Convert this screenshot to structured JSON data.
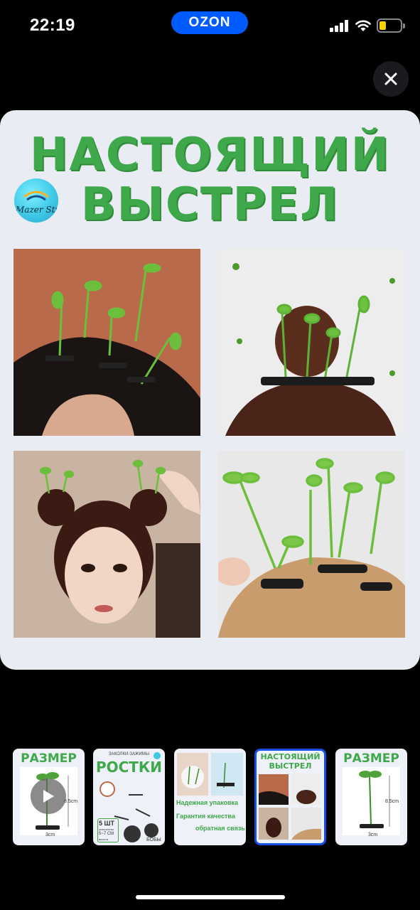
{
  "status_bar": {
    "time": "22:19",
    "brand": "OZON"
  },
  "product_image": {
    "headline_line1": "НАСТОЯЩИЙ",
    "headline_line2": "ВЫСТРЕЛ",
    "logo_text": "Mazer Studi"
  },
  "thumbnails": [
    {
      "title": "РАЗМЕР",
      "dim1": "8.5cm",
      "dim2": "3cm",
      "has_video": true
    },
    {
      "top_text": "ЗАКОЛКИ-ЗАЖИМЫ",
      "title": "РОСТКИ",
      "count": "5 ШТ",
      "count_label": "количество",
      "height": "5~7 СМ",
      "height_label": "высота",
      "brand_word": "БОБЫ"
    },
    {
      "feature1": "Надежная упаковка",
      "feature2": "Гарантия качества",
      "feature3": "обратная связь"
    },
    {
      "title_line1": "НАСТОЯЩИЙ",
      "title_line2": "ВЫСТРЕЛ",
      "active": true
    },
    {
      "title": "РАЗМЕР",
      "dim1": "8.5cm",
      "dim2": "3cm"
    }
  ],
  "colors": {
    "accent_green": "#3fa84a",
    "brand_blue": "#005bff",
    "active_border": "#1450e6"
  },
  "icons": [
    "close-icon",
    "play-icon",
    "wifi-icon",
    "signal-icon",
    "battery-icon"
  ]
}
